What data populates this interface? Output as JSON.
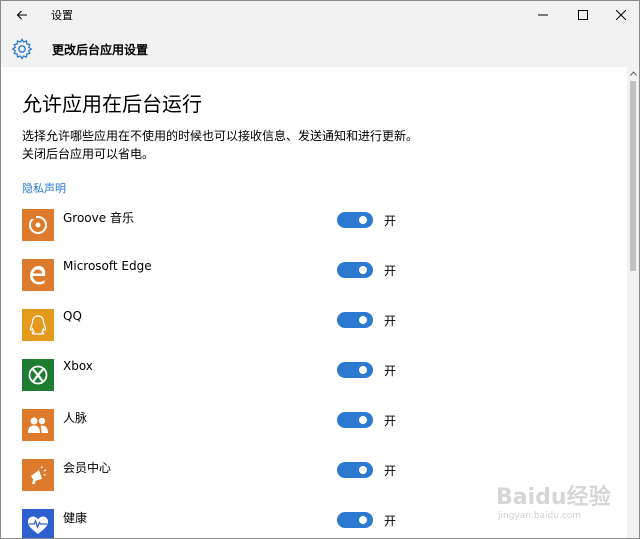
{
  "window": {
    "title": "设置"
  },
  "header": {
    "title": "更改后台应用设置"
  },
  "page": {
    "title": "允许应用在后台运行",
    "description": "选择允许哪些应用在不使用的时候也可以接收信息、发送通知和进行更新。关闭后台应用可以省电。",
    "privacy_link": "隐私声明"
  },
  "apps": [
    {
      "name": "Groove 音乐",
      "toggle_state": "开",
      "on": true,
      "icon": "groove-music-icon",
      "color": "#dd7a2b"
    },
    {
      "name": "Microsoft Edge",
      "toggle_state": "开",
      "on": true,
      "icon": "edge-icon",
      "color": "#dd7a2b"
    },
    {
      "name": "QQ",
      "toggle_state": "开",
      "on": true,
      "icon": "qq-icon",
      "color": "#e59a1e"
    },
    {
      "name": "Xbox",
      "toggle_state": "开",
      "on": true,
      "icon": "xbox-icon",
      "color": "#1e7d31"
    },
    {
      "name": "人脉",
      "toggle_state": "开",
      "on": true,
      "icon": "people-icon",
      "color": "#dd7a2b"
    },
    {
      "name": "会员中心",
      "toggle_state": "开",
      "on": true,
      "icon": "megaphone-icon",
      "color": "#dd7a2b"
    },
    {
      "name": "健康",
      "toggle_state": "开",
      "on": true,
      "icon": "health-icon",
      "color": "#2d5fcf"
    }
  ],
  "watermark": {
    "brand": "Baidu经验",
    "url": "jingyan.baidu.com"
  },
  "colors": {
    "accent": "#2b79d0",
    "titlebar_bg": "#f2f2f2"
  }
}
